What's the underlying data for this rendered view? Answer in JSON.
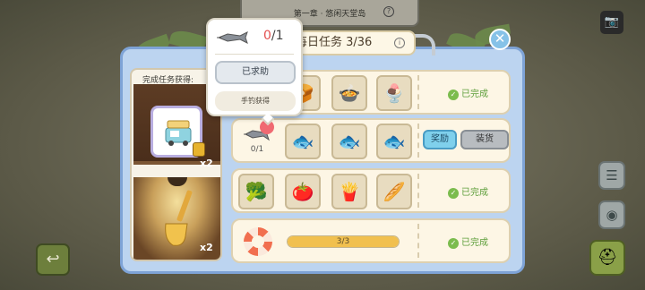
{
  "background": {
    "chapter_title": "第一章 · 悠闲天堂岛",
    "help_symbol": "?"
  },
  "colors": {
    "panel_bg": "#bcd4f0",
    "row_bg": "#fdf6e5",
    "done_green": "#5d9e3a",
    "progress_fill": "#f1c04f",
    "count_red": "#e34f4f"
  },
  "header": {
    "title": "每日任务 3/36",
    "info_symbol": "i",
    "close_symbol": "✕"
  },
  "reward_panel": {
    "title": "完成任务获得:",
    "items": [
      {
        "icon": "food-truck-icon",
        "quantity": "x2",
        "locked": true
      },
      {
        "icon": "golden-shovel-icon",
        "quantity": "x2",
        "locked": false
      }
    ]
  },
  "tasks": [
    {
      "slots": [
        {
          "icon": "bread-icon",
          "glyph": "🍞"
        },
        {
          "icon": "soup-bowl-icon",
          "glyph": "🍲"
        },
        {
          "icon": "parfait-icon",
          "glyph": "🍨"
        }
      ],
      "status": "已完成"
    },
    {
      "requirement": {
        "icon": "swordfish-icon",
        "current": "0",
        "total": "/1",
        "count_text": "0/1"
      },
      "slots": [
        {
          "icon": "fish-icon",
          "glyph": "🐟"
        },
        {
          "icon": "fish-icon",
          "glyph": "🐟"
        },
        {
          "icon": "fish-icon",
          "glyph": "🐟"
        }
      ],
      "reward_button": "奖励",
      "load_button": "装货"
    },
    {
      "slots": [
        {
          "icon": "broccoli-icon",
          "glyph": "🥦"
        },
        {
          "icon": "tomato-icon",
          "glyph": "🍅"
        },
        {
          "icon": "fries-icon",
          "glyph": "🍟"
        },
        {
          "icon": "baguette-icon",
          "glyph": "🥖"
        }
      ],
      "status": "已完成"
    },
    {
      "icon": "life-ring-icon",
      "progress": {
        "label": "3/3",
        "fraction": 1.0
      },
      "status": "已完成"
    }
  ],
  "tooltip": {
    "item_icon": "swordfish-icon",
    "current": "0",
    "total": "/1",
    "help_button": "已求助",
    "source": "手钓获得"
  },
  "side_buttons": {
    "camera": "📷",
    "back": "↩",
    "list": "☰",
    "bowl": "◉",
    "helmet": "⛑"
  }
}
